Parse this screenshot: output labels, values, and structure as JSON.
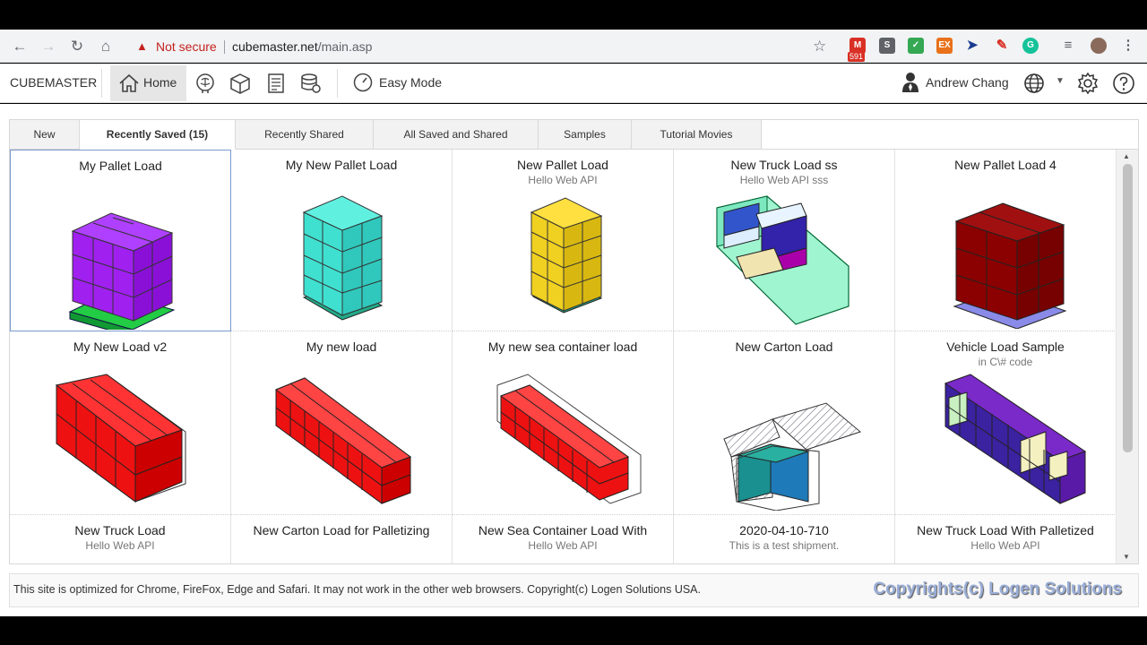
{
  "browser": {
    "security_label": "Not secure",
    "url_host": "cubemaster.net",
    "url_path": "/main.asp",
    "mail_badge": "591"
  },
  "header": {
    "brand": "CUBEMASTER",
    "home_label": "Home",
    "easy_mode_label": "Easy Mode",
    "user_name": "Andrew Chang"
  },
  "tabs": [
    {
      "label": "New"
    },
    {
      "label": "Recently Saved (15)"
    },
    {
      "label": "Recently Shared"
    },
    {
      "label": "All Saved and Shared"
    },
    {
      "label": "Samples"
    },
    {
      "label": "Tutorial Movies"
    }
  ],
  "cards": [
    {
      "title": "My Pallet Load",
      "subtitle": ""
    },
    {
      "title": "My New Pallet Load",
      "subtitle": ""
    },
    {
      "title": "New Pallet Load",
      "subtitle": "Hello Web API"
    },
    {
      "title": "New Truck Load ss",
      "subtitle": "Hello Web API sss"
    },
    {
      "title": "New Pallet Load 4",
      "subtitle": ""
    },
    {
      "title": "My New Load v2",
      "subtitle": ""
    },
    {
      "title": "My new load",
      "subtitle": ""
    },
    {
      "title": "My new sea container load",
      "subtitle": ""
    },
    {
      "title": "New Carton Load",
      "subtitle": ""
    },
    {
      "title": "Vehicle Load Sample",
      "subtitle": "in C\\# code"
    },
    {
      "title": "New Truck Load",
      "subtitle": "Hello Web API"
    },
    {
      "title": "New Carton Load for Palletizing",
      "subtitle": ""
    },
    {
      "title": "New Sea Container Load With",
      "subtitle": "Hello Web API"
    },
    {
      "title": "2020-04-10-710",
      "subtitle": "This is a test shipment."
    },
    {
      "title": "New Truck Load With Palletized",
      "subtitle": "Hello Web API"
    }
  ],
  "footer": {
    "notice": "This site is optimized for Chrome, FireFox, Edge and Safari. It may not work in the other web browsers. Copyright(c) Logen Solutions USA.",
    "watermark": "Copyrights(c) Logen Solutions"
  },
  "colors": {
    "purple": "#a020f0",
    "cyan": "#40e0d0",
    "yellow": "#f0d020",
    "maroon": "#8b0000",
    "red": "#ee1111"
  }
}
